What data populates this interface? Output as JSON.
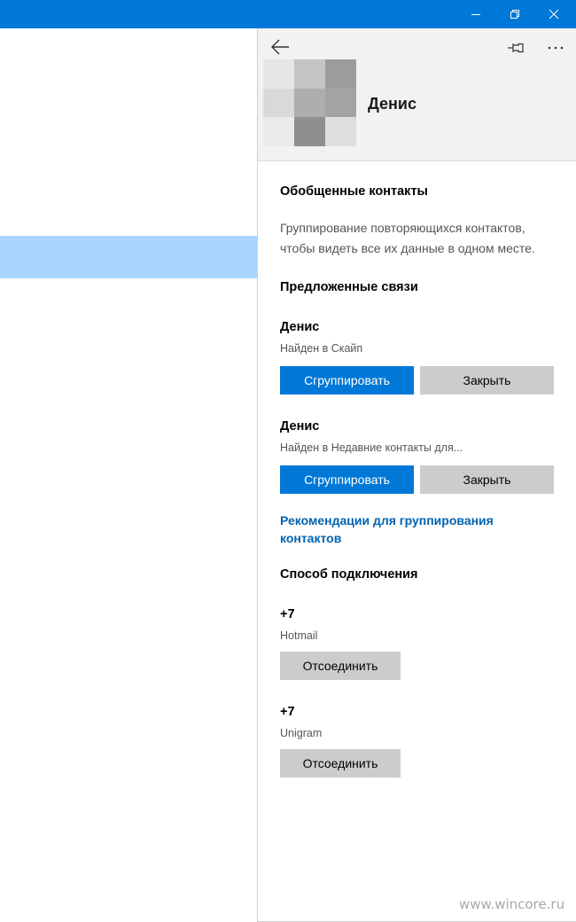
{
  "window": {
    "titlebar_color": "#0078d7",
    "controls": [
      {
        "name": "minimize-button",
        "icon": "minimize-icon"
      },
      {
        "name": "restore-button",
        "icon": "restore-icon"
      },
      {
        "name": "close-button",
        "icon": "close-icon"
      }
    ]
  },
  "list": {
    "selected_color": "#a8d6ff"
  },
  "contact_panel": {
    "header": {
      "back_icon": "back-arrow-icon",
      "pin_icon": "pin-icon",
      "more_icon": "more-options-icon",
      "name": "Денис",
      "avatar_pixels": [
        "#e6e6e6",
        "#c4c4c4",
        "#9c9c9c",
        "#d9d9d9",
        "#aeaeae",
        "#a3a3a3",
        "#ebebeb",
        "#8f8f8f",
        "#dedede"
      ]
    },
    "linked_contacts": {
      "title": "Обобщенные контакты",
      "description": "Группирование повторяющихся контактов, чтобы видеть все их данные в одном месте."
    },
    "suggested_links": {
      "title": "Предложенные связи",
      "items": [
        {
          "name": "Денис",
          "source": "Найден в Скайп",
          "group_label": "Сгруппировать",
          "close_label": "Закрыть"
        },
        {
          "name": "Денис",
          "source": "Найден в Недавние контакты для...",
          "group_label": "Сгруппировать",
          "close_label": "Закрыть"
        }
      ],
      "recommendations_link": "Рекомендации для группирования контактов"
    },
    "connection": {
      "title": "Способ подключения",
      "accounts": [
        {
          "number": "+7",
          "service": "Hotmail",
          "disconnect_label": "Отсоединить"
        },
        {
          "number": "+7",
          "service": "Unigram",
          "disconnect_label": "Отсоединить"
        }
      ]
    },
    "colors": {
      "accent": "#0078d7",
      "link": "#0063b1",
      "secondary_button": "#cccccc"
    }
  },
  "watermark": "www.wincore.ru"
}
